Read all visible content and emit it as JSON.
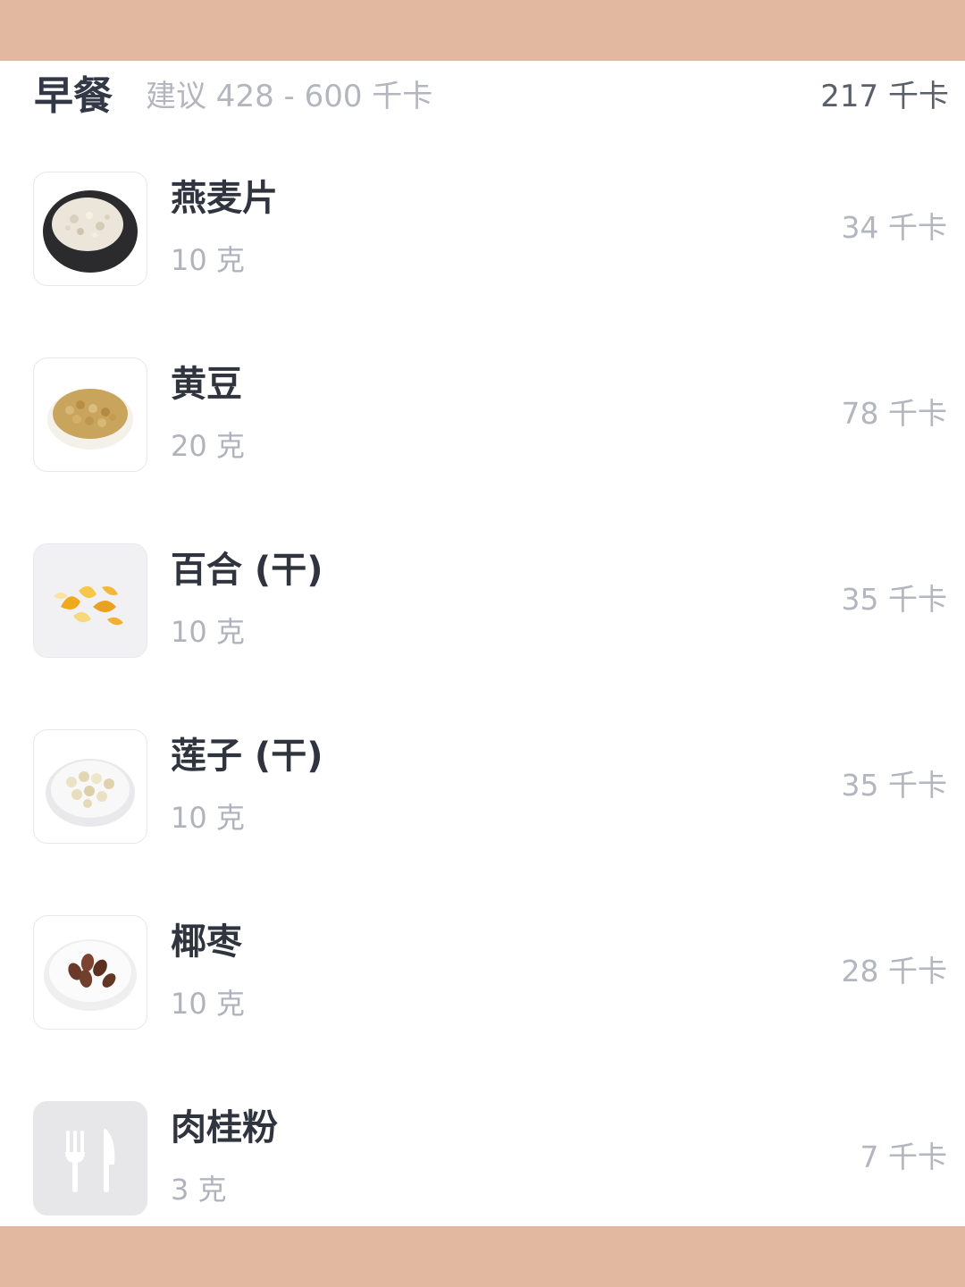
{
  "meal": {
    "title": "早餐",
    "suggestion": "建议 428 - 600 千卡",
    "total": "217 千卡"
  },
  "foods": [
    {
      "name": "燕麦片",
      "amount": "10 克",
      "kcal": "34 千卡",
      "icon": "oatmeal-image"
    },
    {
      "name": "黄豆",
      "amount": "20 克",
      "kcal": "78 千卡",
      "icon": "soybean-image"
    },
    {
      "name": "百合 (干)",
      "amount": "10 克",
      "kcal": "35 千卡",
      "icon": "dried-lily-image"
    },
    {
      "name": "莲子 (干)",
      "amount": "10 克",
      "kcal": "35 千卡",
      "icon": "lotus-seed-image"
    },
    {
      "name": "椰枣",
      "amount": "10 克",
      "kcal": "28 千卡",
      "icon": "date-image"
    },
    {
      "name": "肉桂粉",
      "amount": "3 克",
      "kcal": "7 千卡",
      "icon": "fork-knife-icon"
    }
  ]
}
